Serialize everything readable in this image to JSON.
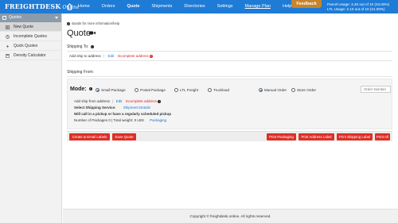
{
  "brand": {
    "name": "FREIGHTDESK",
    "suffix": "Online"
  },
  "nav": {
    "items": [
      "Home",
      "Orders",
      "Quote",
      "Shipments",
      "Directories",
      "Settings",
      "Manage Plan",
      "Help"
    ],
    "active": "Quote"
  },
  "feedback_label": "Feedback",
  "usage": {
    "parcel": "Parcel Usage: 3.40 out of 10 (34.00%)",
    "ltl": "LTL Usage: 2.10 out of 10 (21.00%)"
  },
  "sidebar": {
    "header": "Quotes",
    "items": [
      {
        "label": "New Quote",
        "icon": "new-quote-icon",
        "selected": true
      },
      {
        "label": "Incomplete Quotes",
        "icon": "incomplete-icon",
        "selected": false
      },
      {
        "label": "Quick Quotes",
        "icon": "quick-quote-icon",
        "selected": false
      },
      {
        "label": "Density Calculator",
        "icon": "calculator-icon",
        "selected": false
      }
    ]
  },
  "info_line": "stands for more information/help",
  "page_title": "Quote",
  "shipping_to": {
    "label": "Shipping To:",
    "add_address": "Add ship to address",
    "edit": "Edit",
    "incomplete": "Incomplete address"
  },
  "shipping_from": {
    "label": "Shipping From:",
    "mode_label": "Mode:",
    "modes": [
      "Small Package",
      "Postal Package",
      "LTL Freight",
      "Truckload"
    ],
    "selected_mode": "Small Package",
    "order_types": [
      "Manual Order",
      "Store Order"
    ],
    "selected_order_type": "Manual Order",
    "order_number_placeholder": "Order Number",
    "add_address": "Add ship from address",
    "edit": "Edit",
    "incomplete": "Incomplete address",
    "select_service_label": "Select Shipping Service:",
    "shipment_details": "Shipment Details",
    "pickup_note": "Will call in a pickup or have a regularly scheduled pickup",
    "packages_summary": "Number of Packages 0 | Total weight: 0 LBS",
    "packaging_link": "Packaging"
  },
  "buttons": {
    "create_email": "Create & Email Labels",
    "save_quote": "Save Quote",
    "print_packaging": "Print Packaging",
    "print_address": "Print Address Label",
    "print_shipping": "Print Shipping Label",
    "print_all": "Print All"
  },
  "footer": "Copyright © freightdesk.online. All rights reserved.",
  "colors": {
    "nav_blue": "#1e7bd6",
    "feedback": "#c8842c",
    "button_red": "#dd2f26",
    "link": "#1a73c9",
    "error": "#d9262b"
  }
}
